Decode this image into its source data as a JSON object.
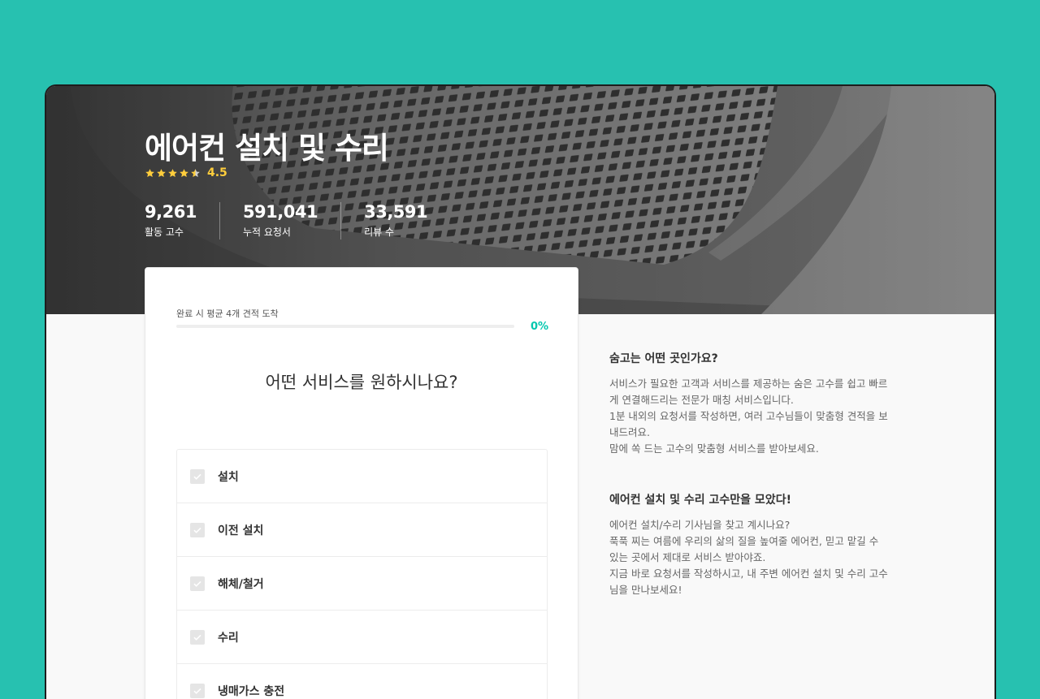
{
  "hero": {
    "title": "에어컨 설치 및 수리",
    "rating": "4.5",
    "stats": [
      {
        "value": "9,261",
        "label": "활동 고수"
      },
      {
        "value": "591,041",
        "label": "누적 요청서"
      },
      {
        "value": "33,591",
        "label": "리뷰 수"
      }
    ]
  },
  "request_card": {
    "progress_label": "완료 시 평균 4개 견적 도착",
    "progress_percent": "0%",
    "progress_value": 0,
    "question": "어떤 서비스를 원하시나요?",
    "options": [
      {
        "label": "설치",
        "checked": false
      },
      {
        "label": "이전 설치",
        "checked": false
      },
      {
        "label": "해체/철거",
        "checked": false
      },
      {
        "label": "수리",
        "checked": false
      },
      {
        "label": "냉매가스 충전",
        "checked": false
      }
    ]
  },
  "info": {
    "section1_title": "숨고는 어떤 곳인가요?",
    "section1_body": "서비스가 필요한 고객과 서비스를 제공하는 숨은 고수를 쉽고 빠르게 연결해드리는 전문가 매칭 서비스입니다.\n1분 내외의 요청서를 작성하면, 여러 고수님들이 맞춤형 견적을 보내드려요.\n맘에 쏙 드는 고수의 맞춤형 서비스를 받아보세요.",
    "section2_title": "에어컨 설치 및 수리 고수만을 모았다!",
    "section2_body": "에어컨 설치/수리 기사님을 찾고 계시나요?\n푹푹 찌는 여름에 우리의 삶의 질을 높여줄 에어컨, 믿고 맡길 수 있는 곳에서 제대로 서비스 받아야죠.\n지금 바로 요청서를 작성하시고, 내 주변 에어컨 설치 및 수리 고수님을 만나보세요!"
  },
  "colors": {
    "background": "#27c1b0",
    "accent": "#00c7ae",
    "star": "#ffcd3c"
  }
}
